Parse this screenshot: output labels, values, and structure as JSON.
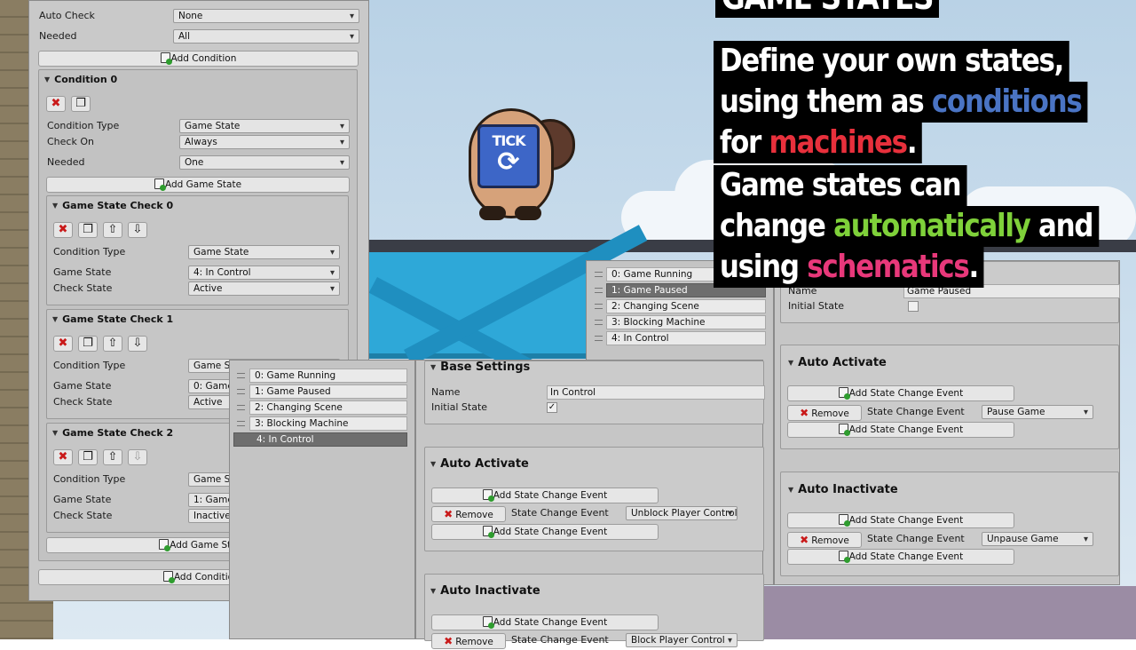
{
  "overlay": {
    "title": "GAME STATES",
    "lines": [
      {
        "parts": [
          "Define your own states,"
        ]
      },
      {
        "parts": [
          "using them as ",
          "conditions"
        ]
      },
      {
        "parts": [
          "for ",
          "machines",
          "."
        ]
      },
      {
        "parts": [
          "Game states can"
        ]
      },
      {
        "parts": [
          "change ",
          "automatically",
          " and"
        ]
      },
      {
        "parts": [
          "using ",
          "schematics",
          "."
        ]
      }
    ],
    "colors": {
      "conditions": "#4a74c4",
      "machines": "#e8303c",
      "automatically": "#7fd13a",
      "schematics": "#e8387a"
    }
  },
  "scene": {
    "sign_text": "TICK",
    "sign_icon": "refresh-icon"
  },
  "left_panel": {
    "auto_check": {
      "label": "Auto Check",
      "value": "None"
    },
    "needed": {
      "label": "Needed",
      "value": "All"
    },
    "add_condition": "Add Condition",
    "condition": {
      "title": "Condition 0",
      "condition_type": {
        "label": "Condition Type",
        "value": "Game State"
      },
      "check_on": {
        "label": "Check On",
        "value": "Always"
      },
      "needed": {
        "label": "Needed",
        "value": "One"
      },
      "add_game_state": "Add Game State",
      "checks": [
        {
          "title": "Game State Check 0",
          "type_label": "Condition Type",
          "type": "Game State",
          "state_label": "Game State",
          "state": "4: In Control",
          "check_label": "Check State",
          "check": "Active"
        },
        {
          "title": "Game State Check 1",
          "type_label": "Condition Type",
          "type": "Game St",
          "state_label": "Game State",
          "state": "0: Game",
          "check_label": "Check State",
          "check": "Active"
        },
        {
          "title": "Game State Check 2",
          "type_label": "Condition Type",
          "type": "Game St",
          "state_label": "Game State",
          "state": "1: Game",
          "check_label": "Check State",
          "check": "Inactive"
        }
      ],
      "add_game_state_bottom": "Add Game Sta"
    },
    "add_condition_bottom": "Add Conditio"
  },
  "mid_list": {
    "items": [
      "0: Game Running",
      "1: Game Paused",
      "2: Changing Scene",
      "3: Blocking Machine",
      "4: In Control"
    ],
    "selected": 4
  },
  "mid_panel": {
    "base_settings": "Base Settings",
    "name_label": "Name",
    "name_value": "In Control",
    "initial_state_label": "Initial State",
    "initial_state_mark": "✓",
    "auto_activate": "Auto Activate",
    "auto_inactivate": "Auto Inactivate",
    "add_event": "Add State Change Event",
    "remove": "Remove",
    "event_label": "State Change Event",
    "activate_event": "Unblock Player Control",
    "inactivate_event": "Block Player Control"
  },
  "right_list": {
    "items": [
      "0: Game Running",
      "1: Game Paused",
      "2: Changing Scene",
      "3: Blocking Machine",
      "4: In Control"
    ],
    "selected": 1
  },
  "right_panel": {
    "name_label": "Name",
    "name_value": "Game Paused",
    "initial_state_label": "Initial State",
    "auto_activate": "Auto Activate",
    "auto_inactivate": "Auto Inactivate",
    "add_event": "Add State Change Event",
    "remove": "Remove",
    "event_label": "State Change Event",
    "activate_event": "Pause Game",
    "inactivate_event": "Unpause Game"
  }
}
